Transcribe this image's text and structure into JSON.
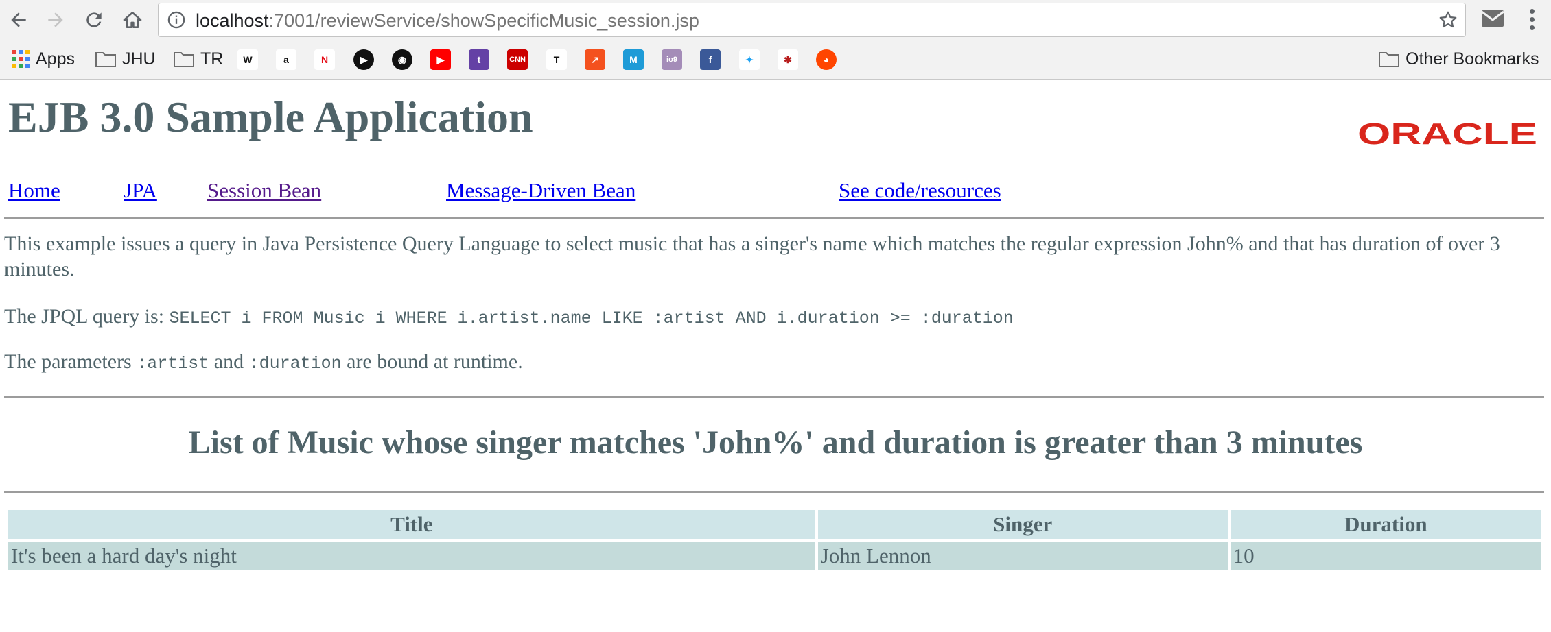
{
  "browser": {
    "url_host": "localhost",
    "url_path": ":7001/reviewService/showSpecificMusic_session.jsp",
    "bookmarks": [
      {
        "label": "Apps",
        "icon": "apps-grid-icon"
      },
      {
        "label": "JHU",
        "icon": "folder-icon"
      },
      {
        "label": "TR",
        "icon": "folder-icon"
      }
    ],
    "favicons": [
      {
        "name": "wikipedia-icon",
        "glyph": "W",
        "color": "#ffffff",
        "fg": "#111111"
      },
      {
        "name": "amazon-icon",
        "glyph": "a",
        "color": "#ffffff",
        "fg": "#111111"
      },
      {
        "name": "netflix-icon",
        "glyph": "N",
        "color": "#ffffff",
        "fg": "#e50914"
      },
      {
        "name": "play-circle-icon",
        "glyph": "▶",
        "color": "#111111",
        "fg": "#ffffff"
      },
      {
        "name": "record-circle-icon",
        "glyph": "◉",
        "color": "#111111",
        "fg": "#ffffff"
      },
      {
        "name": "youtube-icon",
        "glyph": "▶",
        "color": "#ff0000",
        "fg": "#ffffff"
      },
      {
        "name": "twitch-icon",
        "glyph": "t",
        "color": "#6441a5",
        "fg": "#ffffff"
      },
      {
        "name": "cnn-icon",
        "glyph": "CNN",
        "color": "#cc0000",
        "fg": "#ffffff"
      },
      {
        "name": "nytimes-icon",
        "glyph": "T",
        "color": "#ffffff",
        "fg": "#111111"
      },
      {
        "name": "trending-icon",
        "glyph": "↗",
        "color": "#f4511e",
        "fg": "#ffffff"
      },
      {
        "name": "medium-icon",
        "glyph": "M",
        "color": "#1e9bd7",
        "fg": "#ffffff"
      },
      {
        "name": "io9-icon",
        "glyph": "io9",
        "color": "#a48cb8",
        "fg": "#ffffff"
      },
      {
        "name": "facebook-icon",
        "glyph": "f",
        "color": "#3b5998",
        "fg": "#ffffff"
      },
      {
        "name": "twitter-icon",
        "glyph": "✦",
        "color": "#ffffff",
        "fg": "#1da1f2"
      },
      {
        "name": "spider-icon",
        "glyph": "✱",
        "color": "#ffffff",
        "fg": "#b71c1c"
      },
      {
        "name": "reddit-icon",
        "glyph": "◕",
        "color": "#ff4500",
        "fg": "#ffffff"
      }
    ],
    "other_bookmarks": "Other Bookmarks"
  },
  "page": {
    "title": "EJB 3.0 Sample Application",
    "logo_text": "ORACLE",
    "nav": {
      "home": "Home",
      "jpa": "JPA",
      "session_bean": "Session Bean",
      "mdb": "Message-Driven Bean",
      "code": "See code/resources"
    },
    "intro": "This example issues a query in Java Persistence Query Language to select music that has a singer's name which matches the regular expression John% and that has duration of over 3 minutes.",
    "query_label": "The JPQL query is: ",
    "query_code": "SELECT i FROM Music i WHERE i.artist.name LIKE :artist AND i.duration >= :duration",
    "params_prefix": "The parameters ",
    "param_artist": ":artist",
    "params_and": " and ",
    "param_duration": ":duration",
    "params_suffix": " are bound at runtime.",
    "list_title": "List of Music whose singer matches 'John%' and duration is greater than 3 minutes",
    "table": {
      "headers": {
        "title": "Title",
        "singer": "Singer",
        "duration": "Duration"
      },
      "rows": [
        {
          "title": "It's been a hard day's night",
          "singer": "John Lennon",
          "duration": "10"
        }
      ]
    }
  }
}
